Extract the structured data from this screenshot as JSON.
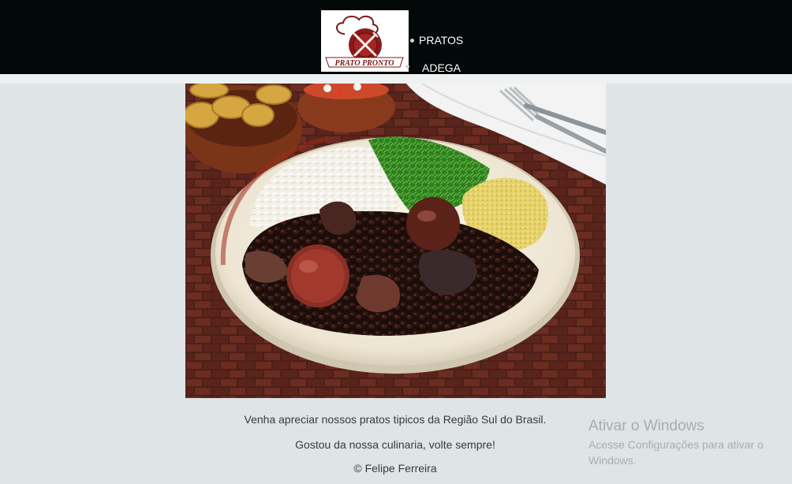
{
  "logo": {
    "text": "PRATO PRONTO"
  },
  "nav": {
    "items": [
      {
        "label": "PRATOS"
      },
      {
        "label": "ADEGA"
      }
    ]
  },
  "main": {
    "intro": "Venha apreciar nossos pratos tipicos da Região Sul do Brasil.",
    "thanks": "Gostou da nossa culinaria, volte sempre!",
    "credit": "© Felipe Ferreira"
  },
  "watermark": {
    "title": "Ativar o Windows",
    "subtitle": "Acesse Configurações para ativar o Windows."
  },
  "colors": {
    "header_bg": "#030809",
    "page_bg": "#dfe4e6",
    "logo_red": "#8b1a1a"
  }
}
